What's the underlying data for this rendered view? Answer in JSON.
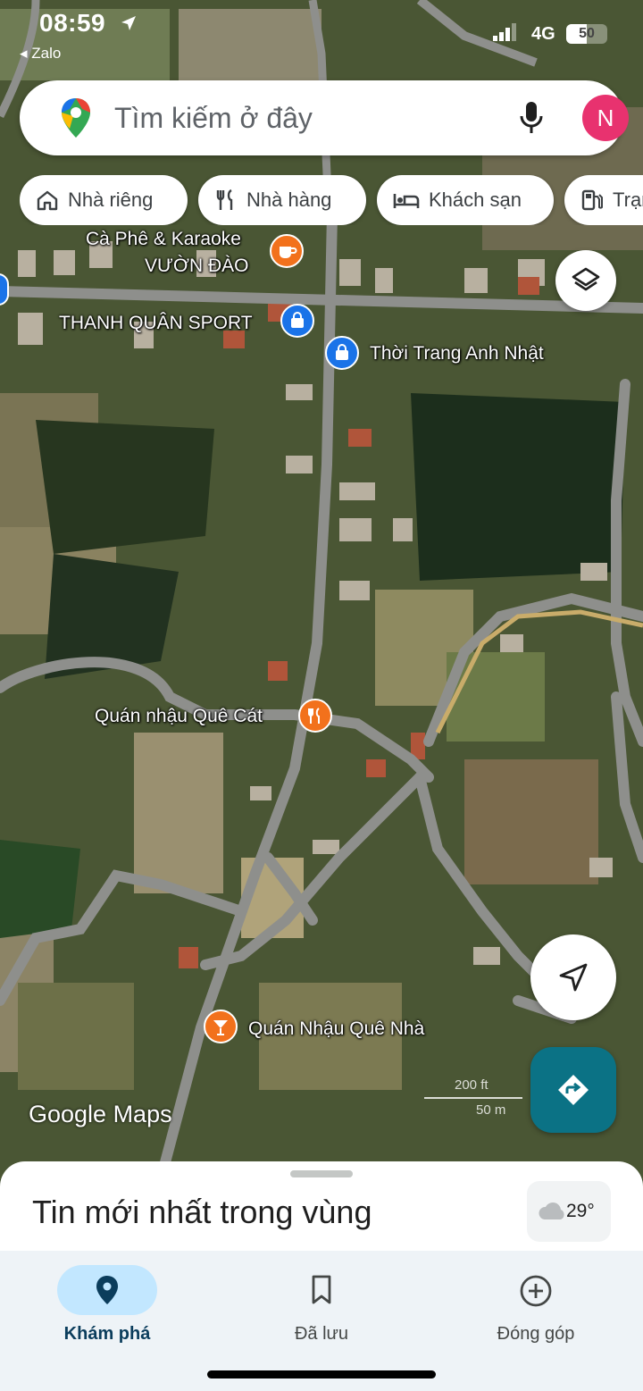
{
  "status_bar": {
    "time": "08:59",
    "back_app": "◂ Zalo",
    "network": "4G",
    "battery": "50",
    "battery_fraction": 0.5
  },
  "search": {
    "placeholder": "Tìm kiếm ở đây",
    "avatar_letter": "N"
  },
  "chips": [
    {
      "label": "Nhà riêng",
      "icon": "home-icon"
    },
    {
      "label": "Nhà hàng",
      "icon": "restaurant-icon"
    },
    {
      "label": "Khách sạn",
      "icon": "hotel-icon"
    },
    {
      "label": "Trạm xăng",
      "icon": "gas-station-icon"
    }
  ],
  "map": {
    "pois": [
      {
        "name_line1": "Cà Phê & Karaoke",
        "name_line2": "VƯỜN ĐÀO",
        "icon": "cafe-icon",
        "color": "#f2711c"
      },
      {
        "name": "THANH QUÂN SPORT",
        "icon": "shopping-icon",
        "color": "#1a73e8"
      },
      {
        "name": "Thời Trang Anh Nhật",
        "icon": "shopping-icon",
        "color": "#1a73e8"
      },
      {
        "name": "Quán nhậu Quê Cát",
        "icon": "restaurant-icon",
        "color": "#f2711c"
      },
      {
        "name": "Quán Nhậu Quê Nhà",
        "icon": "bar-icon",
        "color": "#f2711c"
      }
    ],
    "logo": "Google Maps",
    "scale_top": "200 ft",
    "scale_bottom": "50 m"
  },
  "sheet": {
    "title": "Tin mới nhất trong vùng",
    "temperature": "29°"
  },
  "nav": {
    "items": [
      {
        "label": "Khám phá",
        "icon": "explore-pin-icon",
        "active": true
      },
      {
        "label": "Đã lưu",
        "icon": "bookmark-icon",
        "active": false
      },
      {
        "label": "Đóng góp",
        "icon": "add-circle-icon",
        "active": false
      }
    ]
  },
  "colors": {
    "accent": "#0b7285",
    "active_pill": "#c2e7ff",
    "avatar": "#e8326f"
  }
}
